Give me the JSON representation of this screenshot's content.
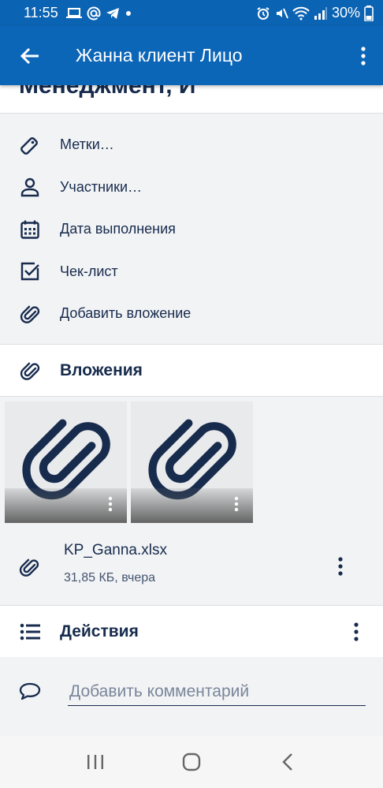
{
  "status_bar": {
    "time": "11:55",
    "battery": "30%"
  },
  "app_bar": {
    "title": "Жанна клиент Лицо"
  },
  "card": {
    "partial_title": "Менеджмент, И"
  },
  "menu": {
    "items": [
      {
        "label": "Метки…",
        "icon": "tag-icon"
      },
      {
        "label": "Участники…",
        "icon": "person-icon"
      },
      {
        "label": "Дата выполнения",
        "icon": "calendar-icon"
      },
      {
        "label": "Чек-лист",
        "icon": "checkbox-icon"
      },
      {
        "label": "Добавить вложение",
        "icon": "paperclip-icon"
      }
    ]
  },
  "attachments": {
    "title": "Вложения",
    "file": {
      "name": "KP_Ganna.xlsx",
      "meta": "31,85 КБ, вчера"
    }
  },
  "actions": {
    "title": "Действия"
  },
  "comment": {
    "placeholder": "Добавить комментарий"
  },
  "colors": {
    "app_bar": "#0c66b8",
    "text_dark": "#172b4d"
  }
}
